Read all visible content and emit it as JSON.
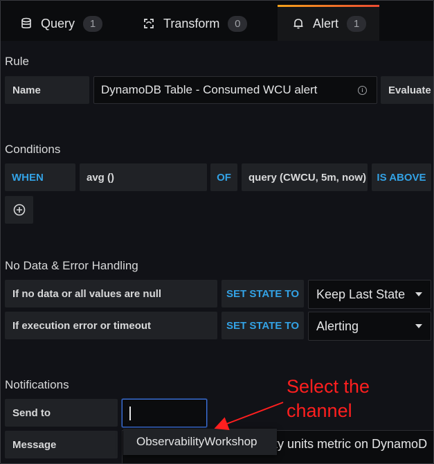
{
  "tabs": [
    {
      "label": "Query",
      "count": "1",
      "icon": "database-icon"
    },
    {
      "label": "Transform",
      "count": "0",
      "icon": "transform-icon"
    },
    {
      "label": "Alert",
      "count": "1",
      "icon": "bell-icon"
    }
  ],
  "active_tab": "Alert",
  "colors": {
    "accent": "#33a2e5",
    "focus": "#3d71d9",
    "annotation": "#ff1f1f",
    "tab_highlight": "#f5661b"
  },
  "rule": {
    "title": "Rule",
    "name_label": "Name",
    "name_value": "DynamoDB Table - Consumed WCU alert",
    "evaluate_label": "Evaluate e"
  },
  "conditions": {
    "title": "Conditions",
    "when": "WHEN",
    "reducer": "avg ()",
    "of": "OF",
    "query": "query (CWCU, 5m, now)",
    "evaluator": "IS ABOVE"
  },
  "nodata": {
    "title": "No Data & Error Handling",
    "row1_label": "If no data or all values are null",
    "row1_keyword": "SET STATE TO",
    "row1_value": "Keep Last State",
    "row2_label": "If execution error or timeout",
    "row2_keyword": "SET STATE TO",
    "row2_value": "Alerting"
  },
  "notifications": {
    "title": "Notifications",
    "send_to_label": "Send to",
    "send_to_value": "",
    "message_label": "Message",
    "message_value": "ty units metric on DynamoD",
    "dropdown_option": "ObservabilityWorkshop"
  },
  "annotation": {
    "line1": "Select the",
    "line2": "channel"
  }
}
